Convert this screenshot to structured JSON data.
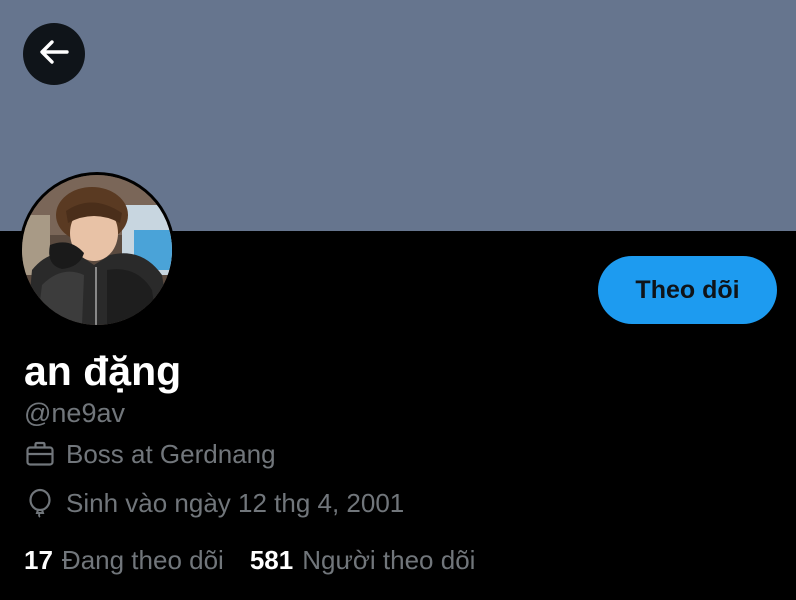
{
  "profile": {
    "display_name": "an đặng",
    "handle": "@ne9av",
    "job": "Boss at Gerdnang",
    "birthday": "Sinh vào ngày 12 thg 4, 2001"
  },
  "actions": {
    "follow_label": "Theo dõi"
  },
  "stats": {
    "following_count": "17",
    "following_label": "Đang theo dõi",
    "followers_count": "581",
    "followers_label": "Người theo dõi"
  },
  "icons": {
    "back": "arrow-left-icon",
    "job": "briefcase-icon",
    "birthday": "balloon-icon"
  },
  "colors": {
    "banner": "#66758e",
    "background": "#000000",
    "accent": "#1d9bf0",
    "secondary_text": "#71767b"
  }
}
